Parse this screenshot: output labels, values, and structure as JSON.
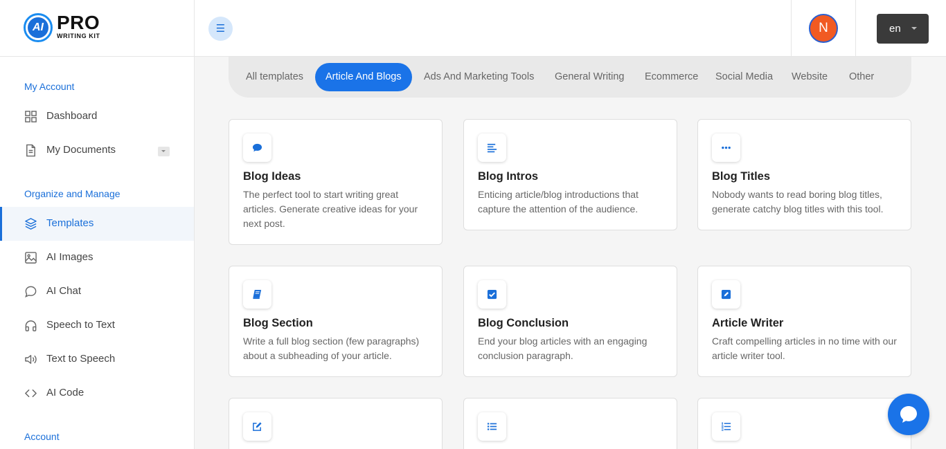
{
  "brand": {
    "logo_mark": "AI",
    "name": "PRO",
    "tagline": "WRITING KIT"
  },
  "header": {
    "menu_icon": "hamburger-icon",
    "avatar_initial": "N",
    "language": "en",
    "accent_color": "#1a73e8"
  },
  "sidebar": {
    "sections": [
      {
        "title": "My Account"
      },
      {
        "title": "Organize and Manage"
      },
      {
        "title": "Account"
      }
    ],
    "items": [
      {
        "label": "Dashboard",
        "icon": "grid-icon"
      },
      {
        "label": "My Documents",
        "icon": "document-icon"
      },
      {
        "label": "Templates",
        "icon": "layers-icon",
        "active": true
      },
      {
        "label": "AI Images",
        "icon": "image-icon"
      },
      {
        "label": "AI Chat",
        "icon": "chat-icon"
      },
      {
        "label": "Speech to Text",
        "icon": "headphones-icon"
      },
      {
        "label": "Text to Speech",
        "icon": "speaker-icon"
      },
      {
        "label": "AI Code",
        "icon": "code-icon"
      }
    ]
  },
  "filters": {
    "tabs": [
      {
        "label": "All templates"
      },
      {
        "label": "Article And Blogs",
        "active": true
      },
      {
        "label": "Ads And Marketing Tools"
      },
      {
        "label": "General Writing"
      },
      {
        "label": "Ecommerce"
      },
      {
        "label": "Social Media"
      },
      {
        "label": "Website"
      },
      {
        "label": "Other"
      }
    ]
  },
  "templates": [
    {
      "title": "Blog Ideas",
      "description": "The perfect tool to start writing great articles. Generate creative ideas for your next post.",
      "icon": "speech-bubble-icon"
    },
    {
      "title": "Blog Intros",
      "description": "Enticing article/blog introductions that capture the attention of the audience.",
      "icon": "align-left-icon"
    },
    {
      "title": "Blog Titles",
      "description": "Nobody wants to read boring blog titles, generate catchy blog titles with this tool.",
      "icon": "ellipsis-icon"
    },
    {
      "title": "Blog Section",
      "description": "Write a full blog section (few paragraphs) about a subheading of your article.",
      "icon": "book-icon"
    },
    {
      "title": "Blog Conclusion",
      "description": "End your blog articles with an engaging conclusion paragraph.",
      "icon": "check-square-icon"
    },
    {
      "title": "Article Writer",
      "description": "Craft compelling articles in no time with our article writer tool.",
      "icon": "pen-square-icon"
    },
    {
      "title": "",
      "description": "",
      "icon": "edit-icon"
    },
    {
      "title": "",
      "description": "",
      "icon": "list-icon"
    },
    {
      "title": "",
      "description": "",
      "icon": "ordered-list-icon"
    }
  ],
  "chat_widget": {
    "icon": "chat-bubble-icon"
  }
}
